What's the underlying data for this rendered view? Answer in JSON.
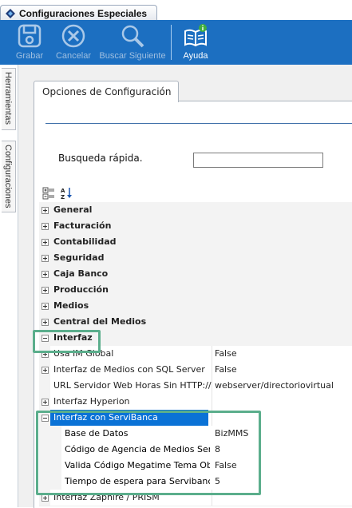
{
  "window": {
    "tab_title": "Configuraciones Especiales"
  },
  "toolbar": {
    "buttons": [
      {
        "label": "Grabar",
        "icon": "disk-icon",
        "enabled": false
      },
      {
        "label": "Cancelar",
        "icon": "cancel-icon",
        "enabled": false
      },
      {
        "label": "Buscar Siguiente",
        "icon": "magnifier-icon",
        "enabled": false
      },
      {
        "label": "Ayuda",
        "icon": "help-book-icon",
        "enabled": true
      }
    ]
  },
  "side_tabs": [
    "Herramientas",
    "Configuraciones"
  ],
  "options_tab": {
    "label": "Opciones de Configuración"
  },
  "search": {
    "label": "Busqueda rápida.",
    "value": ""
  },
  "grid": {
    "rows": [
      {
        "type": "cat",
        "name": "General",
        "expander": "plus"
      },
      {
        "type": "cat",
        "name": "Facturación",
        "expander": "plus"
      },
      {
        "type": "cat",
        "name": "Contabilidad",
        "expander": "plus"
      },
      {
        "type": "cat",
        "name": "Seguridad",
        "expander": "plus"
      },
      {
        "type": "cat",
        "name": "Caja Banco",
        "expander": "plus"
      },
      {
        "type": "cat",
        "name": "Producción",
        "expander": "plus"
      },
      {
        "type": "cat",
        "name": "Medios",
        "expander": "plus"
      },
      {
        "type": "cat",
        "name": "Central del Medios",
        "expander": "plus"
      },
      {
        "type": "cat",
        "name": "Interfaz",
        "expander": "minus"
      },
      {
        "type": "prop",
        "name": "Usa IM Global",
        "value": "False",
        "expander": "plus"
      },
      {
        "type": "prop",
        "name": "Interfaz de Medios con SQL Server",
        "value": "False",
        "expander": "plus"
      },
      {
        "type": "prop",
        "name": "URL Servidor Web Horas Sin HTTP://",
        "value": "webserver/directoriovirtual",
        "expander": "none"
      },
      {
        "type": "prop",
        "name": "Interfaz Hyperion",
        "value": "",
        "expander": "plus"
      },
      {
        "type": "prop",
        "name": "Interfaz con ServiBanca",
        "value": "",
        "expander": "minus",
        "selected": true
      },
      {
        "type": "child",
        "name": "Base de Datos",
        "value": "BizMMS"
      },
      {
        "type": "child",
        "name": "Código de Agencia de Medios ServiBa",
        "value": "8"
      },
      {
        "type": "child",
        "name": "Valida Código Megatime Tema Obligat",
        "value": "False"
      },
      {
        "type": "child",
        "name": "Tiempo de espera para Servibanca",
        "value": "5"
      },
      {
        "type": "prop",
        "name": "Interfaz Zaphire / PRISM",
        "value": "",
        "expander": "plus"
      }
    ]
  },
  "colors": {
    "toolbar": "#1c6fc1",
    "selection": "#0a72d6",
    "highlight": "#5bae8c"
  }
}
